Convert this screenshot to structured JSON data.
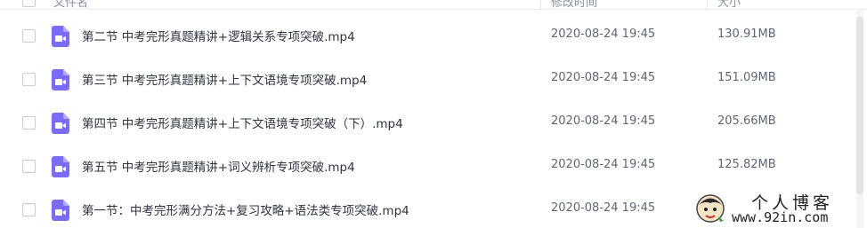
{
  "header": {
    "name_col": "文件名",
    "time_col": "修改时间",
    "size_col": "大小"
  },
  "files": [
    {
      "name": "第二节 中考完形真题精讲+逻辑关系专项突破.mp4",
      "time": "2020-08-24 19:45",
      "size": "130.91MB"
    },
    {
      "name": "第三节 中考完形真题精讲+上下文语境专项突破.mp4",
      "time": "2020-08-24 19:45",
      "size": "151.09MB"
    },
    {
      "name": "第四节 中考完形真题精讲+上下文语境专项突破（下）.mp4",
      "time": "2020-08-24 19:45",
      "size": "205.66MB"
    },
    {
      "name": "第五节 中考完形真题精讲+词义辨析专项突破.mp4",
      "time": "2020-08-24 19:45",
      "size": "125.82MB"
    },
    {
      "name": "第一节：中考完形满分方法+复习攻略+语法类专项突破.mp4",
      "time": "2020-08-24 19:45",
      "size": ""
    }
  ],
  "file_icon": "video-file-icon",
  "watermark": {
    "title": "个人博客",
    "url": "www.92in.com"
  },
  "colors": {
    "icon": "#7b6cf6",
    "text": "#2e3440",
    "muted": "#5f6673",
    "border": "#c9ccd3"
  }
}
